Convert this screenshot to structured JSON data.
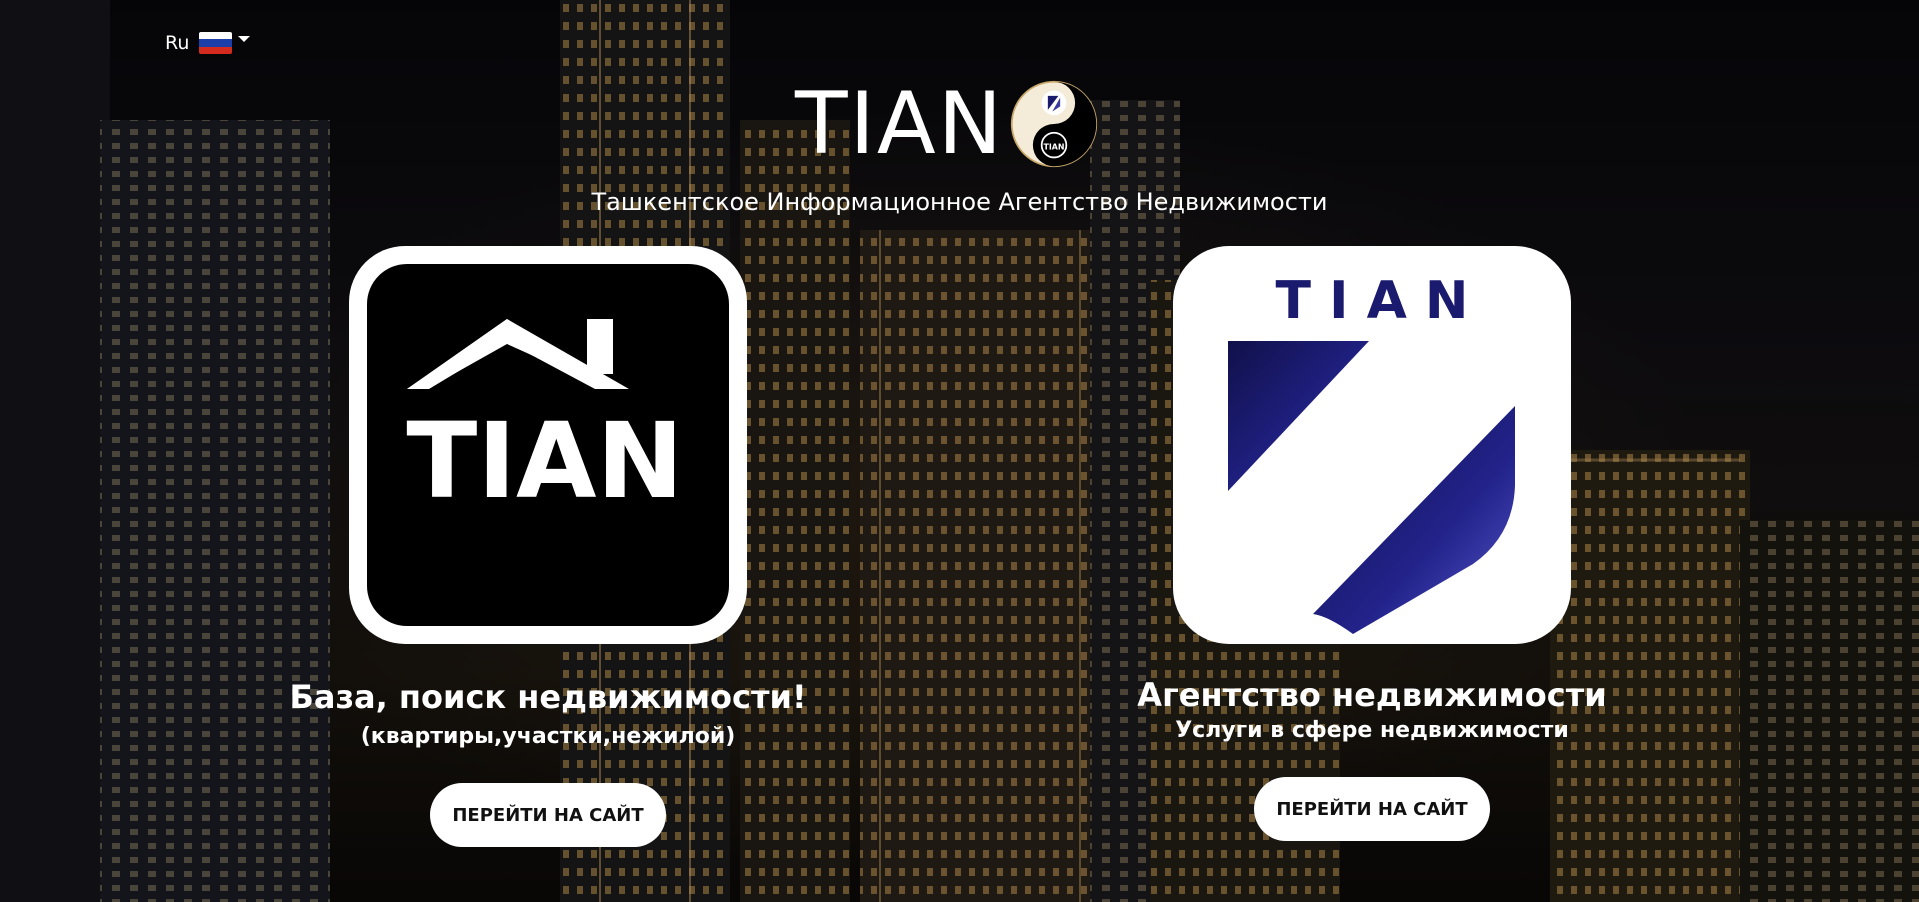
{
  "language": {
    "current": "Ru",
    "flag_colors": [
      "#ffffff",
      "#1c3faa",
      "#d52b1e"
    ]
  },
  "header": {
    "brand": "TIAN",
    "tagline": "Ташкентское Информационное Агентство Недвижимости",
    "emblem_text": "TIAN"
  },
  "cards": [
    {
      "logo_text": "TIAN",
      "title": "База, поиск недвижимости!",
      "subtitle": "(квартиры,участки,нежилой)",
      "button_label": "ПЕРЕЙТИ НА САЙТ"
    },
    {
      "logo_text": "T I A N",
      "title": "Агентство недвижимости",
      "subtitle": "Услуги в сфере недвижимости",
      "button_label": "ПЕРЕЙТИ НА САЙТ"
    }
  ],
  "colors": {
    "navy": "#1a1a6e",
    "button_bg": "#ffffff",
    "button_text": "#111111"
  }
}
